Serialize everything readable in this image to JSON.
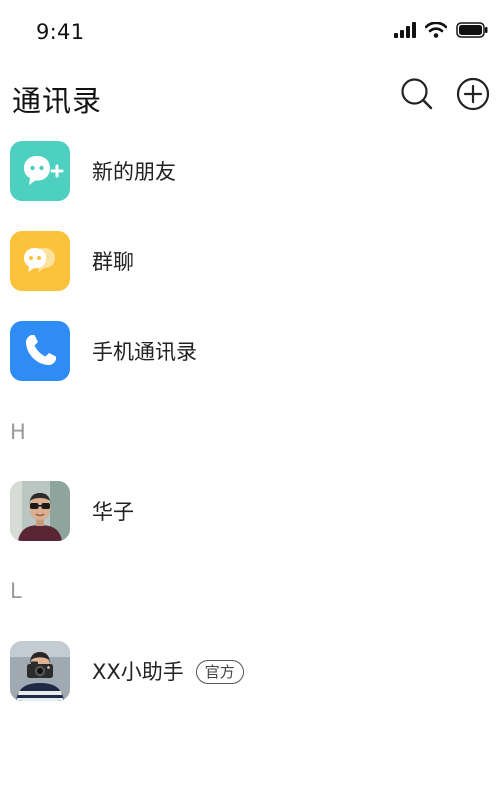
{
  "status_bar": {
    "time": "9:41"
  },
  "header": {
    "title": "通讯录",
    "actions": [
      "search-icon",
      "add-circle-icon"
    ]
  },
  "shortcuts": [
    {
      "label": "新的朋友",
      "icon": "add-friend-icon",
      "color": "#4dd0c0"
    },
    {
      "label": "群聊",
      "icon": "group-chat-icon",
      "color": "#fbc33c"
    },
    {
      "label": "手机通讯录",
      "icon": "phone-icon",
      "color": "#2f8cf4"
    }
  ],
  "sections": [
    {
      "letter": "H",
      "contacts": [
        {
          "name": "华子"
        }
      ]
    },
    {
      "letter": "L",
      "contacts": [
        {
          "name": "XX小助手",
          "badge": "官方"
        }
      ]
    }
  ],
  "colors": {
    "accent_teal": "#4dd0c0",
    "accent_yellow": "#fbc33c",
    "accent_blue": "#2f8cf4",
    "section_letter": "#9a9a9a"
  }
}
